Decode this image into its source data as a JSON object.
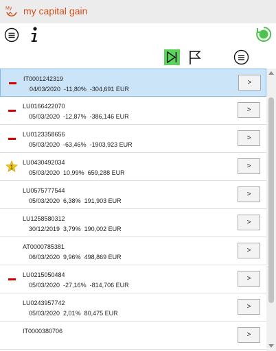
{
  "app": {
    "title": "my capital gain",
    "logo_text": "My",
    "brand_color": "#d44f1e"
  },
  "toolbar": {
    "menu_icon": "menu-circle-icon",
    "info_icon": "info-icon",
    "status_icon": "sync-status-icon",
    "status_color": "#4cc34c",
    "skip_icon": "skip-end-icon",
    "skip_color": "#5bd35b",
    "flag_icon": "flag-icon",
    "list_menu_icon": "menu-circle-icon"
  },
  "rows": [
    {
      "code": "IT0001242319",
      "date": "04/03/2020",
      "pct": "-11,80%",
      "amount": "-304,691 EUR",
      "mark": "minus",
      "selected": true,
      "button": ">"
    },
    {
      "code": "LU0166422070",
      "date": "05/03/2020",
      "pct": "-12,87%",
      "amount": "-386,146 EUR",
      "mark": "minus",
      "selected": false,
      "button": ">"
    },
    {
      "code": "LU0123358656",
      "date": "05/03/2020",
      "pct": "-63,46%",
      "amount": "-1903,923 EUR",
      "mark": "minus",
      "selected": false,
      "button": ">"
    },
    {
      "code": "LU0430492034",
      "date": "05/03/2020",
      "pct": "10,99%",
      "amount": "659,288 EUR",
      "mark": "star",
      "mark_text": "1",
      "selected": false,
      "button": ">"
    },
    {
      "code": "LU0575777544",
      "date": "05/03/2020",
      "pct": "6,38%",
      "amount": "191,903 EUR",
      "mark": "none",
      "selected": false,
      "button": ">"
    },
    {
      "code": "LU1258580312",
      "date": "30/12/2019",
      "pct": "3,79%",
      "amount": "190,002 EUR",
      "mark": "none",
      "selected": false,
      "button": ">"
    },
    {
      "code": "AT0000785381",
      "date": "06/03/2020",
      "pct": "9,96%",
      "amount": "498,869 EUR",
      "mark": "none",
      "selected": false,
      "button": ">"
    },
    {
      "code": "LU0215050484",
      "date": "05/03/2020",
      "pct": "-27,16%",
      "amount": "-814,706 EUR",
      "mark": "minus",
      "selected": false,
      "button": ">"
    },
    {
      "code": "LU0243957742",
      "date": "05/03/2020",
      "pct": "2,01%",
      "amount": "80,475 EUR",
      "mark": "none",
      "selected": false,
      "button": ">"
    },
    {
      "code": "IT0000380706",
      "date": "",
      "pct": "",
      "amount": "",
      "mark": "none",
      "selected": false,
      "button": ">"
    }
  ]
}
